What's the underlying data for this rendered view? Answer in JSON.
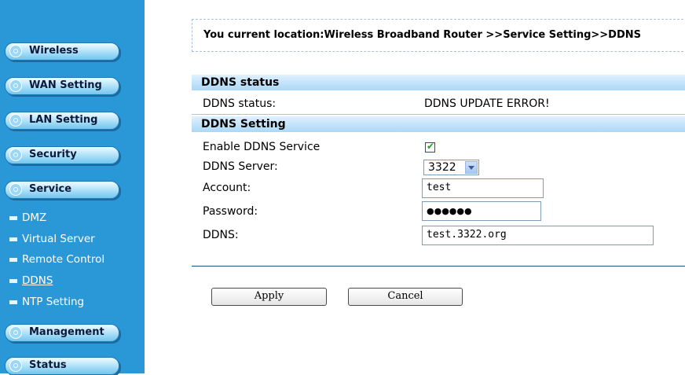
{
  "sidebar": {
    "menu": [
      {
        "label": "Wireless"
      },
      {
        "label": "WAN Setting"
      },
      {
        "label": "LAN Setting"
      },
      {
        "label": "Security"
      },
      {
        "label": "Service"
      }
    ],
    "service_items": [
      {
        "label": "DMZ"
      },
      {
        "label": "Virtual Server"
      },
      {
        "label": "Remote Control"
      },
      {
        "label": "DDNS",
        "active": true
      },
      {
        "label": "NTP Setting"
      }
    ],
    "menu_bottom": [
      {
        "label": "Management"
      },
      {
        "label": "Status"
      }
    ]
  },
  "location": "You current location:Wireless Broadband Router >>Service Setting>>DDNS",
  "ddns_status": {
    "header": "DDNS status",
    "label": "DDNS status:",
    "value": "DDNS UPDATE ERROR!"
  },
  "ddns_setting": {
    "header": "DDNS Setting",
    "enable_label": "Enable DDNS Service",
    "enable_checked": true,
    "server_label": "DDNS Server:",
    "server_value": "3322",
    "account_label": "Account:",
    "account_value": "test",
    "password_label": "Password:",
    "password_value": "●●●●●●",
    "ddns_label": "DDNS:",
    "ddns_value": "test.3322.org"
  },
  "buttons": {
    "apply": "Apply",
    "cancel": "Cancel"
  },
  "colors": {
    "sidebar_bg": "#2a97d6",
    "header_bg": "#aad8f6"
  }
}
